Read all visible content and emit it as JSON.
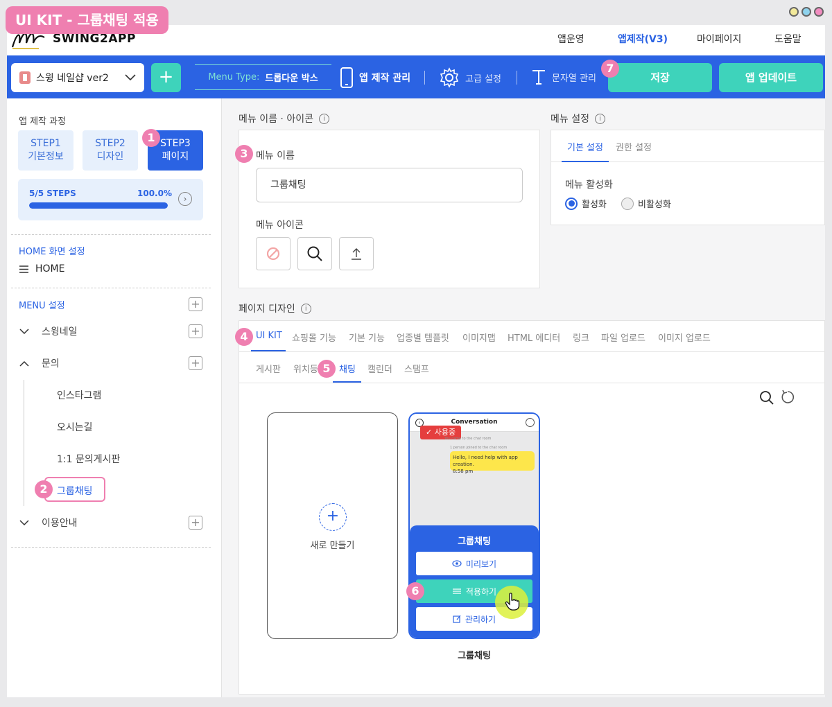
{
  "badge_title": "UI KIT - 그룹채팅 적용",
  "logo_text": "SWING2APP",
  "nav": [
    "앱운영",
    "앱제작(V3)",
    "마이페이지",
    "도움말"
  ],
  "toolbar": {
    "app_name": "스윙 네일샵 ver2",
    "menu_type_label": "Menu Type:",
    "menu_type_value": "드롭다운 박스",
    "app_manage": "앱 제작 관리",
    "advanced": "고급 설정",
    "strings": "문자열 관리",
    "save": "저장",
    "update": "앱 업데이트"
  },
  "colors": {
    "accent_blue": "#2b63e3",
    "accent_teal": "#3ed3bb",
    "pink": "#ef7fb0"
  },
  "badges": [
    "1",
    "2",
    "3",
    "4",
    "5",
    "6",
    "7"
  ],
  "sidebar": {
    "process_title": "앱 제작 과정",
    "steps": [
      {
        "line1": "STEP1",
        "line2": "기본정보"
      },
      {
        "line1": "STEP2",
        "line2": "디자인"
      },
      {
        "line1": "STEP3",
        "line2": "페이지"
      }
    ],
    "progress_label": "5/5 STEPS",
    "progress_pct": "100.0%",
    "progress_value": 1.0,
    "home_section": "HOME 화면 설정",
    "home_item": "HOME",
    "menu_section": "MENU 설정",
    "tree": {
      "swing": "스윙네일",
      "inquiry": "문의",
      "children": [
        "인스타그램",
        "오시는길",
        "1:1 문의게시판",
        "그룹채팅"
      ],
      "guide": "이용안내"
    }
  },
  "menu_name_icon": {
    "title": "메뉴 이름 · 아이콘",
    "name_label": "메뉴 이름",
    "name_value": "그룹채팅",
    "icon_label": "메뉴 아이콘"
  },
  "menu_settings": {
    "title": "메뉴 설정",
    "tabs": [
      "기본 설정",
      "권한 설정"
    ],
    "activation_label": "메뉴 활성화",
    "options": [
      "활성화",
      "비활성화"
    ]
  },
  "page_design": {
    "title": "페이지 디자인",
    "tabs": [
      "UI KIT",
      "쇼핑몰 기능",
      "기본 기능",
      "업종별 템플릿",
      "이미지맵",
      "HTML 에디터",
      "링크",
      "파일 업로드",
      "이미지 업로드"
    ],
    "subtabs": [
      "게시판",
      "위치등",
      "채팅",
      "캘린더",
      "스탬프"
    ],
    "new_card": "새로 만들기",
    "template": {
      "header": "Conversation",
      "in_use": "사용중",
      "sys1": "You came to the chat room",
      "sys2": "1 person joined to the chat room",
      "bubble1": "Hello, I need help with app creation.",
      "bubble_time": "8:58 pm",
      "overlay_title": "그룹채팅",
      "preview": "미리보기",
      "apply": "적용하기",
      "manage": "관리하기",
      "caption": "그룹채팅"
    }
  }
}
